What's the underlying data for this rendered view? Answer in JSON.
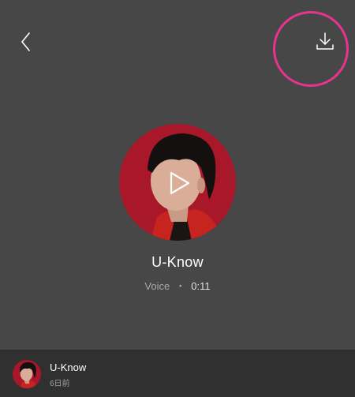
{
  "header": {
    "back_icon": "chevron-left-icon",
    "download_icon": "download-icon",
    "highlight_color": "#e8338f"
  },
  "player": {
    "title": "U-Know",
    "type": "Voice",
    "separator": "・",
    "duration": "0:11",
    "play_icon": "play-icon",
    "avatar_background": "#a8182a"
  },
  "bottom_bar": {
    "name": "U-Know",
    "time": "6日前"
  }
}
